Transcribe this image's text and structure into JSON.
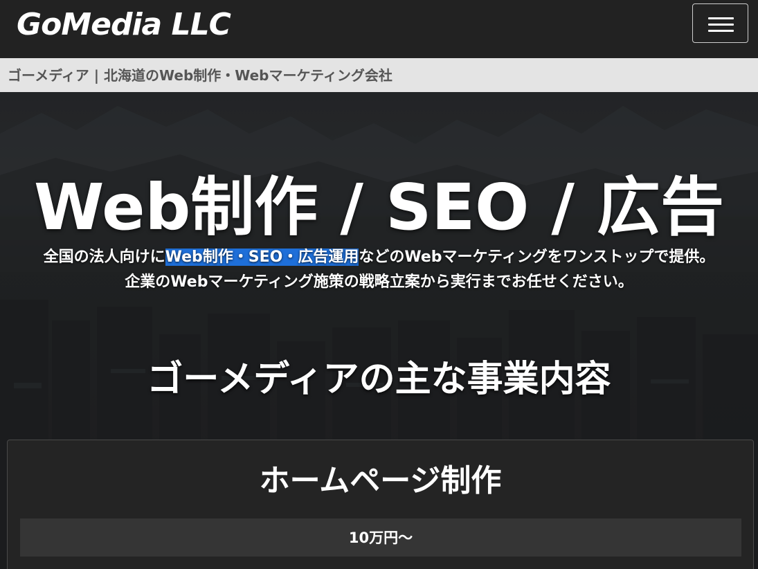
{
  "header": {
    "logo_text": "GoMedia LLC",
    "menu_icon": "hamburger-menu-icon"
  },
  "breadcrumb": {
    "text": "ゴーメディア | 北海道のWeb制作・Webマーケティング会社"
  },
  "hero": {
    "title": "Web制作 / SEO / 広告",
    "sub_line1_pre": "全国の法人向けに",
    "sub_line1_highlight": "Web制作・SEO・広告運用",
    "sub_line1_post": "などのWebマーケティングをワンストップで提供。",
    "sub_line2": "企業のWebマーケティング施策の戦略立案から実行までお任せください。",
    "highlight_color": "#1e6fd9"
  },
  "services": {
    "heading": "ゴーメディアの主な事業内容",
    "items": [
      {
        "title": "ホームページ制作",
        "price": "10万円〜"
      }
    ]
  },
  "colors": {
    "header_bg": "#222222",
    "breadcrumb_bg": "#e4e4e4",
    "breadcrumb_text": "#555555",
    "card_bg": "#242424",
    "price_bg": "#353535"
  }
}
